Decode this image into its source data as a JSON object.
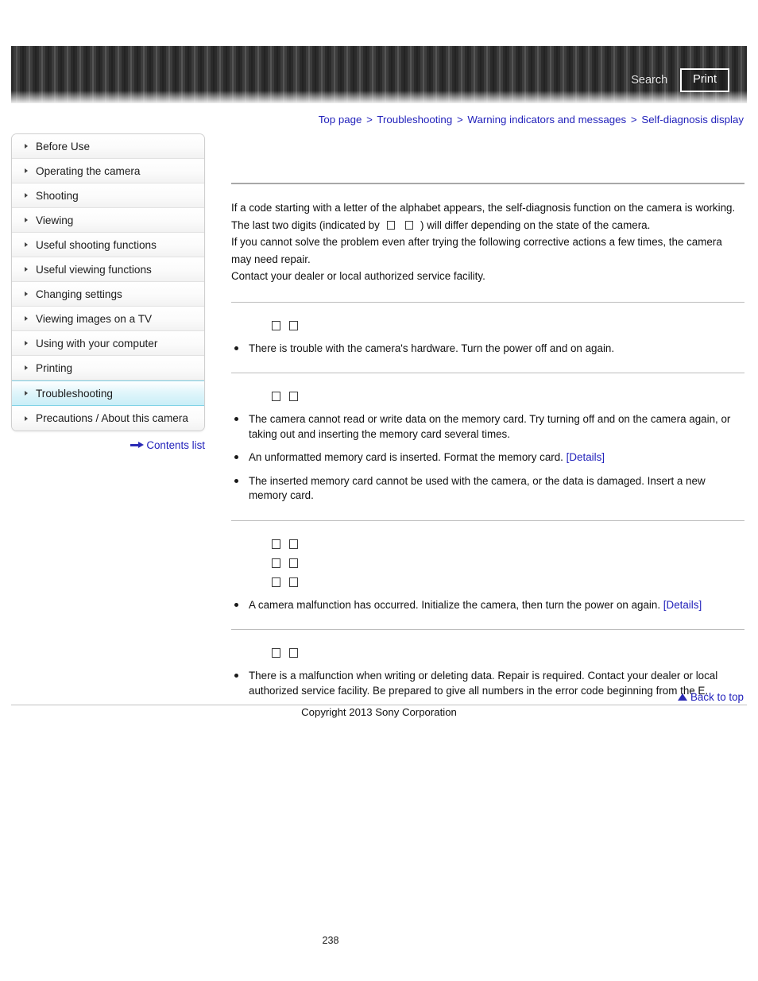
{
  "header": {
    "search_label": "Search",
    "print_label": "Print"
  },
  "breadcrumb": {
    "items": [
      "Top page",
      "Troubleshooting",
      "Warning indicators and messages",
      "Self-diagnosis display"
    ],
    "separator": ">"
  },
  "sidebar": {
    "items": [
      {
        "label": "Before Use",
        "active": false
      },
      {
        "label": "Operating the camera",
        "active": false
      },
      {
        "label": "Shooting",
        "active": false
      },
      {
        "label": "Viewing",
        "active": false
      },
      {
        "label": "Useful shooting functions",
        "active": false
      },
      {
        "label": "Useful viewing functions",
        "active": false
      },
      {
        "label": "Changing settings",
        "active": false
      },
      {
        "label": "Viewing images on a TV",
        "active": false
      },
      {
        "label": "Using with your computer",
        "active": false
      },
      {
        "label": "Printing",
        "active": false
      },
      {
        "label": "Troubleshooting",
        "active": true
      },
      {
        "label": "Precautions / About this camera",
        "active": false
      }
    ],
    "contents_list_label": "Contents list"
  },
  "main": {
    "intro": {
      "line1_part1": "If a code starting with a letter of the alphabet appears, the self-diagnosis function on the camera is working. The last two digits (indicated by",
      "line1_part2": ") will differ depending on the state of the camera.",
      "line2": "If you cannot solve the problem even after trying the following corrective actions a few times, the camera may need repair.",
      "line3": "Contact your dealer or local authorized service facility."
    },
    "sections": [
      {
        "code_lines": 1,
        "bullets": [
          {
            "text": "There is trouble with the camera's hardware. Turn the power off and on again.",
            "link": null
          }
        ]
      },
      {
        "code_lines": 1,
        "bullets": [
          {
            "text": "The camera cannot read or write data on the memory card. Try turning off and on the camera again, or taking out and inserting the memory card several times.",
            "link": null
          },
          {
            "text": "An unformatted memory card is inserted. Format the memory card.",
            "link": "[Details]"
          },
          {
            "text": "The inserted memory card cannot be used with the camera, or the data is damaged. Insert a new memory card.",
            "link": null
          }
        ]
      },
      {
        "code_lines": 3,
        "bullets": [
          {
            "text": "A camera malfunction has occurred. Initialize the camera, then turn the power on again.",
            "link": "[Details]"
          }
        ]
      },
      {
        "code_lines": 1,
        "bullets": [
          {
            "text": "There is a malfunction when writing or deleting data. Repair is required. Contact your dealer or local authorized service facility. Be prepared to give all numbers in the error code beginning from the E.",
            "link": null
          }
        ]
      }
    ]
  },
  "footer": {
    "back_to_top_label": "Back to top",
    "copyright": "Copyright 2013 Sony Corporation",
    "page_number": "238"
  }
}
